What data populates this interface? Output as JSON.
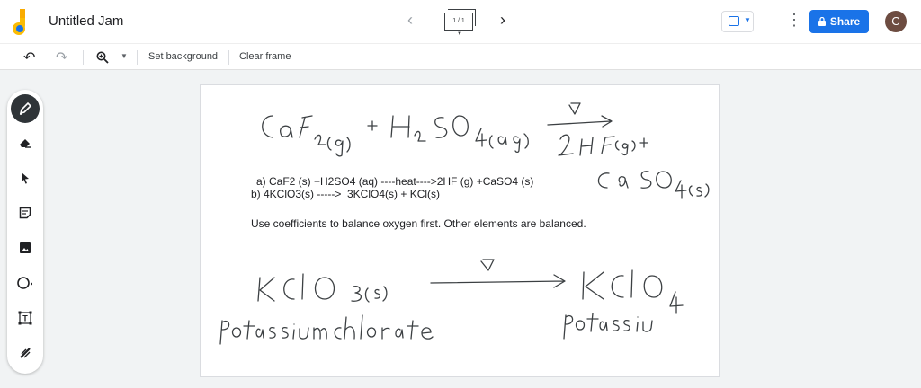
{
  "app": {
    "title": "Untitled Jam"
  },
  "header": {
    "frame_counter": "1 / 1",
    "share_label": "Share",
    "avatar_initial": "C"
  },
  "toolbar": {
    "set_background": "Set background",
    "clear_frame": "Clear frame"
  },
  "canvas": {
    "lines": [
      "a) CaF2 (s) +H2SO4 (aq) ----heat---->2HF (g) +CaSO4 (s)",
      "b) 4KClO3(s) ----->  3KClO4(s) + KCl(s)",
      "Use coefficients to balance oxygen first. Other elements are balanced."
    ]
  },
  "colors": {
    "accent": "#1a73e8",
    "avatar": "#6d4c41",
    "active_tool": "#2f3438"
  },
  "icons": [
    "jamboard-logo",
    "undo-icon",
    "redo-icon",
    "zoom-icon",
    "pen-icon",
    "eraser-icon",
    "select-icon",
    "sticky-note-icon",
    "image-icon",
    "circle-icon",
    "text-box-icon",
    "laser-icon",
    "lock-icon",
    "more-vert-icon",
    "present-icon"
  ]
}
